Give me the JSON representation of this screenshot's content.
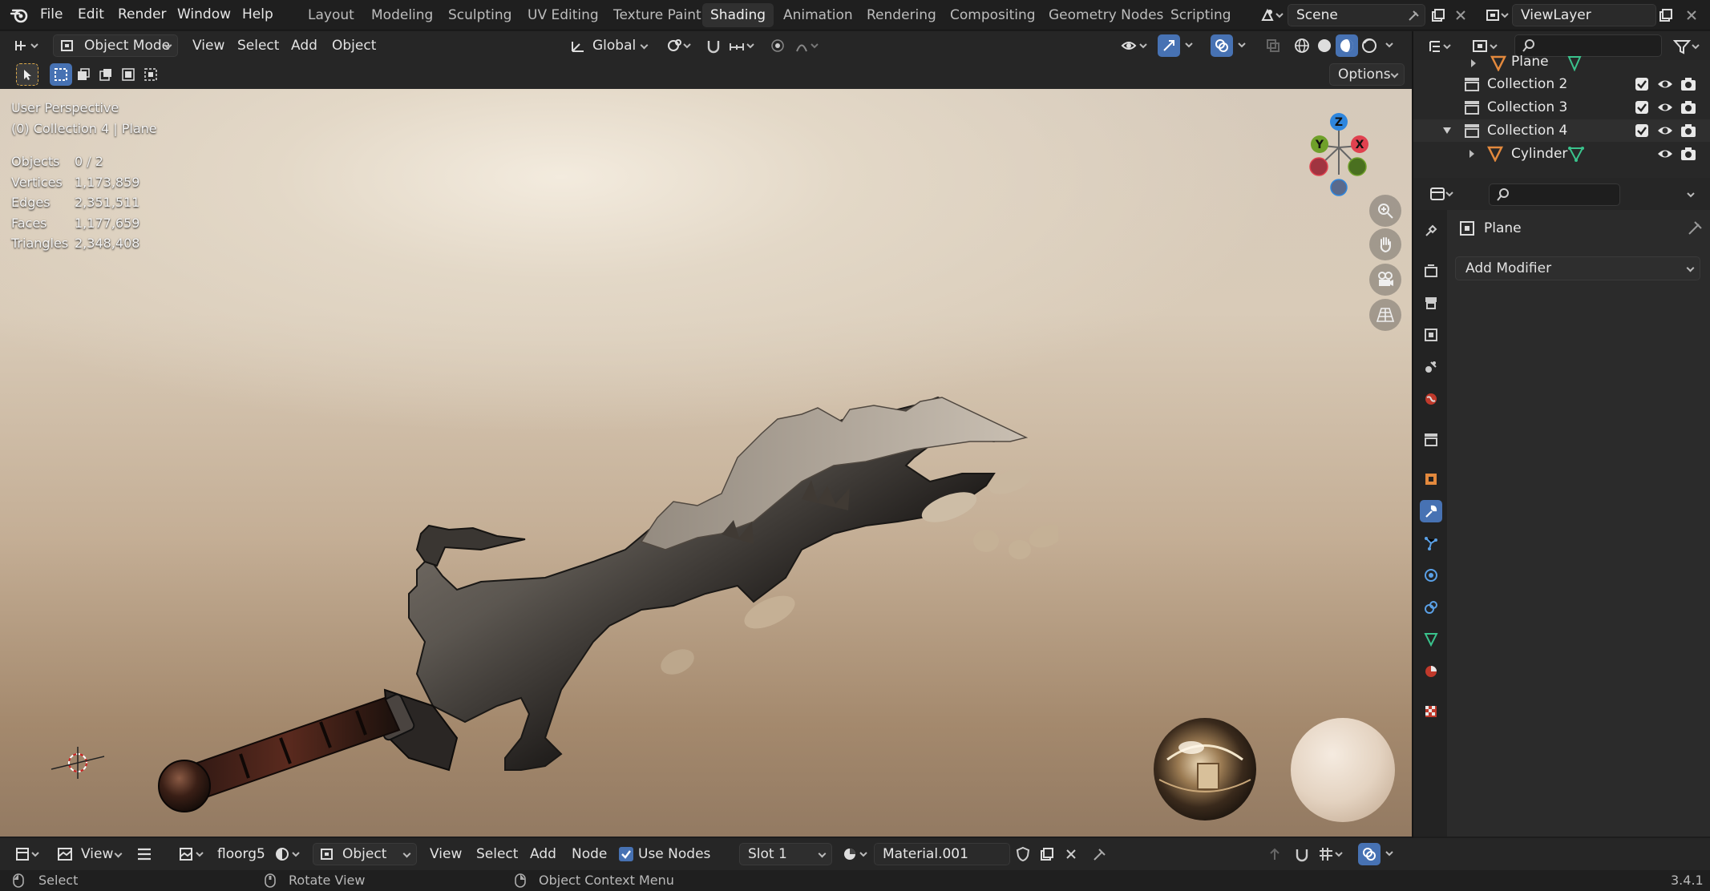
{
  "top_menu": {
    "items": [
      "File",
      "Edit",
      "Render",
      "Window",
      "Help"
    ]
  },
  "workspaces": {
    "tabs": [
      "Layout",
      "Modeling",
      "Sculpting",
      "UV Editing",
      "Texture Paint",
      "Shading",
      "Animation",
      "Rendering",
      "Compositing",
      "Geometry Nodes",
      "Scripting"
    ],
    "active": "Shading"
  },
  "scene": {
    "name": "Scene"
  },
  "view_layer": {
    "name": "ViewLayer"
  },
  "viewport_header": {
    "mode": "Object Mode",
    "menus": [
      "View",
      "Select",
      "Add",
      "Object"
    ],
    "transform_orientation": "Global",
    "options_label": "Options"
  },
  "viewport": {
    "perspective": "User Perspective",
    "context": "(0) Collection 4 | Plane",
    "stats": [
      {
        "label": "Objects",
        "value": "0 / 2"
      },
      {
        "label": "Vertices",
        "value": "1,173,859"
      },
      {
        "label": "Edges",
        "value": "2,351,511"
      },
      {
        "label": "Faces",
        "value": "1,177,659"
      },
      {
        "label": "Triangles",
        "value": "2,348,408"
      }
    ],
    "gizmo": {
      "z": "Z",
      "y": "Y",
      "x": "X"
    }
  },
  "outliner": {
    "rows": [
      {
        "name": "Plane"
      },
      {
        "name": "Collection 2"
      },
      {
        "name": "Collection 3"
      },
      {
        "name": "Collection 4"
      },
      {
        "name": "Cylinder"
      }
    ]
  },
  "properties": {
    "object_name": "Plane",
    "add_modifier_label": "Add Modifier"
  },
  "node_header": {
    "view_label": "View",
    "world_name": "floorg5",
    "shader_type": "Object",
    "menus": [
      "View",
      "Select",
      "Add",
      "Node"
    ],
    "use_nodes_label": "Use Nodes",
    "slot": "Slot 1",
    "material": "Material.001"
  },
  "statusbar": {
    "select": "Select",
    "rotate": "Rotate View",
    "context_menu": "Object Context Menu",
    "version": "3.4.1"
  },
  "colors": {
    "accent_blue": "#4772b3",
    "axis_x": "#e0414f",
    "axis_y": "#6fa02a",
    "axis_z": "#2e86de",
    "mesh_green": "#3ac28c",
    "object_orange": "#e3893d"
  }
}
